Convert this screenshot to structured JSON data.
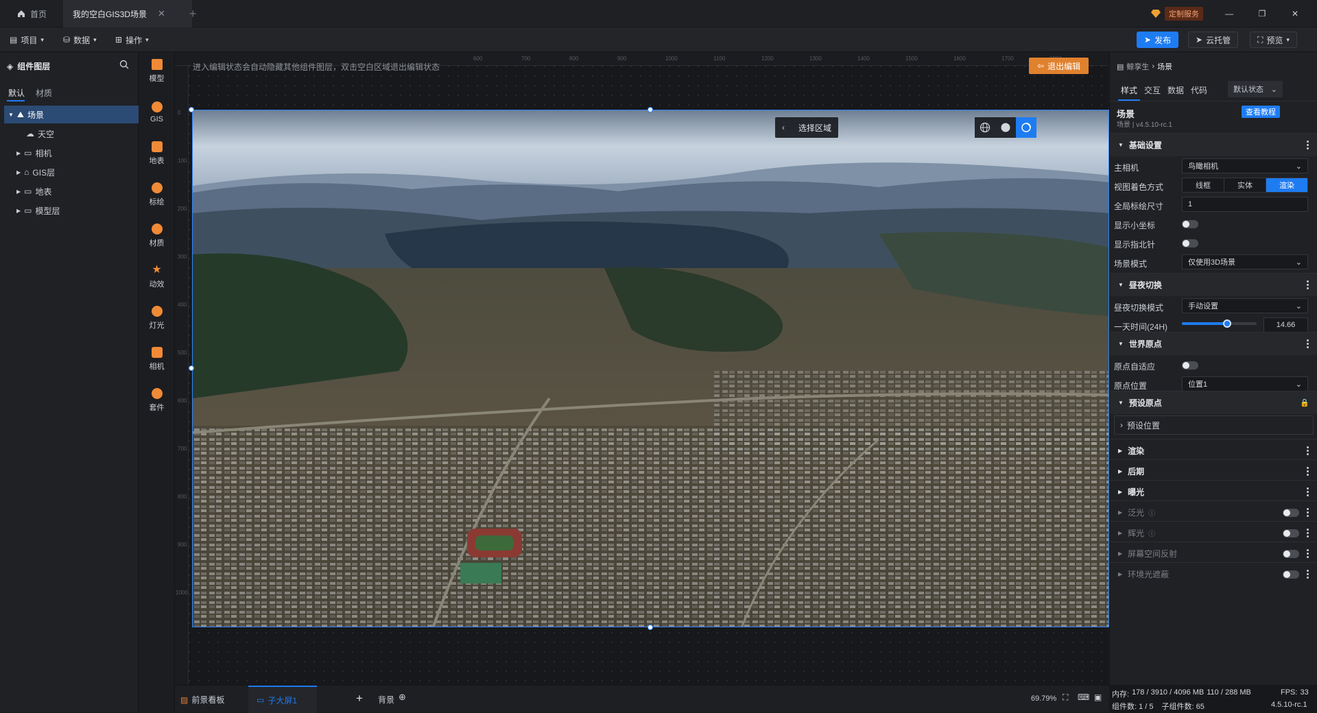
{
  "tabs": {
    "home_label": "首页",
    "active_label": "我的空白GIS3D场景",
    "service_label": "定制服务"
  },
  "toolbar": {
    "project_label": "项目",
    "data_label": "数据",
    "operate_label": "操作",
    "publish_label": "发布",
    "cloud_label": "云托管",
    "preview_label": "预览"
  },
  "layers_panel": {
    "title": "组件图层",
    "tabs": [
      "默认",
      "材质"
    ],
    "items": [
      {
        "label": "场景"
      },
      {
        "label": "天空"
      },
      {
        "label": "相机"
      },
      {
        "label": "GIS层"
      },
      {
        "label": "地表"
      },
      {
        "label": "模型层"
      }
    ]
  },
  "iconbar": {
    "items": [
      {
        "label": "模型",
        "icon": "model-icon"
      },
      {
        "label": "GIS",
        "icon": "gis-icon"
      },
      {
        "label": "地表",
        "icon": "terrain-icon"
      },
      {
        "label": "标绘",
        "icon": "marker-icon"
      },
      {
        "label": "材质",
        "icon": "material-icon"
      },
      {
        "label": "动效",
        "icon": "effect-icon"
      },
      {
        "label": "灯光",
        "icon": "light-icon"
      },
      {
        "label": "相机",
        "icon": "camera-icon"
      },
      {
        "label": "套件",
        "icon": "kit-icon"
      }
    ]
  },
  "canvas": {
    "hint": "进入编辑状态会自动隐藏其他组件图层，双击空白区域退出编辑状态",
    "exit_edit_label": "退出编辑",
    "select_region_label": "选择区域",
    "ruler_top": [
      "600",
      "700",
      "800",
      "900",
      "1000",
      "1100",
      "1200",
      "1300",
      "1400",
      "1500",
      "1600",
      "1700",
      "1800"
    ],
    "ruler_left": [
      "0",
      "100",
      "200",
      "300",
      "400",
      "500",
      "600",
      "700",
      "800",
      "900",
      "1000"
    ]
  },
  "bottom": {
    "tabs": [
      "前景看板",
      "子大屏1"
    ],
    "background_label": "背景",
    "zoom": "69.79%"
  },
  "props": {
    "breadcrumb_root": "鲸孪生",
    "breadcrumb_current": "场景",
    "tabs": [
      "样式",
      "交互",
      "数据",
      "代码"
    ],
    "state_label": "默认状态",
    "title": "场景",
    "subtitle": "场景 | v4.5.10-rc.1",
    "tutorial_label": "查看教程",
    "basic": {
      "section": "基础设置",
      "main_camera_label": "主相机",
      "main_camera_value": "鸟瞰相机",
      "shading_label": "视图着色方式",
      "shading_options": [
        "线框",
        "实体",
        "渲染"
      ],
      "shading_selected": "渲染",
      "marker_size_label": "全局标绘尺寸",
      "marker_size_value": "1",
      "show_axes_label": "显示小坐标",
      "show_compass_label": "显示指北针",
      "scene_mode_label": "场景模式",
      "scene_mode_value": "仅使用3D场景"
    },
    "daynight": {
      "section": "昼夜切换",
      "mode_label": "昼夜切换模式",
      "mode_value": "手动设置",
      "time_label": "一天时间(24H)",
      "time_value": "14.66",
      "time_fraction": 0.61
    },
    "origin": {
      "section": "世界原点",
      "auto_label": "原点自适应",
      "position_label": "原点位置",
      "position_value": "位置1"
    },
    "preset": {
      "section": "预设原点",
      "item_label": "预设位置"
    },
    "collapsed_sections": [
      "渲染",
      "后期",
      "曝光"
    ],
    "toggle_sections": [
      "泛光",
      "辉光",
      "屏幕空间反射",
      "环境光遮蔽"
    ]
  },
  "status": {
    "memory_label": "内存:",
    "memory_value": "178 / 3910 / 4096 MB",
    "gpu_value": "110 / 288 MB",
    "fps_label": "FPS:",
    "fps_value": "33",
    "components": "组件数: 1 / 5",
    "child_components": "子组件数: 65",
    "version": "4.5.10-rc.1"
  },
  "colors": {
    "accent": "#1e7cf2",
    "orange": "#f08a36",
    "selection": "#2b4a74"
  }
}
